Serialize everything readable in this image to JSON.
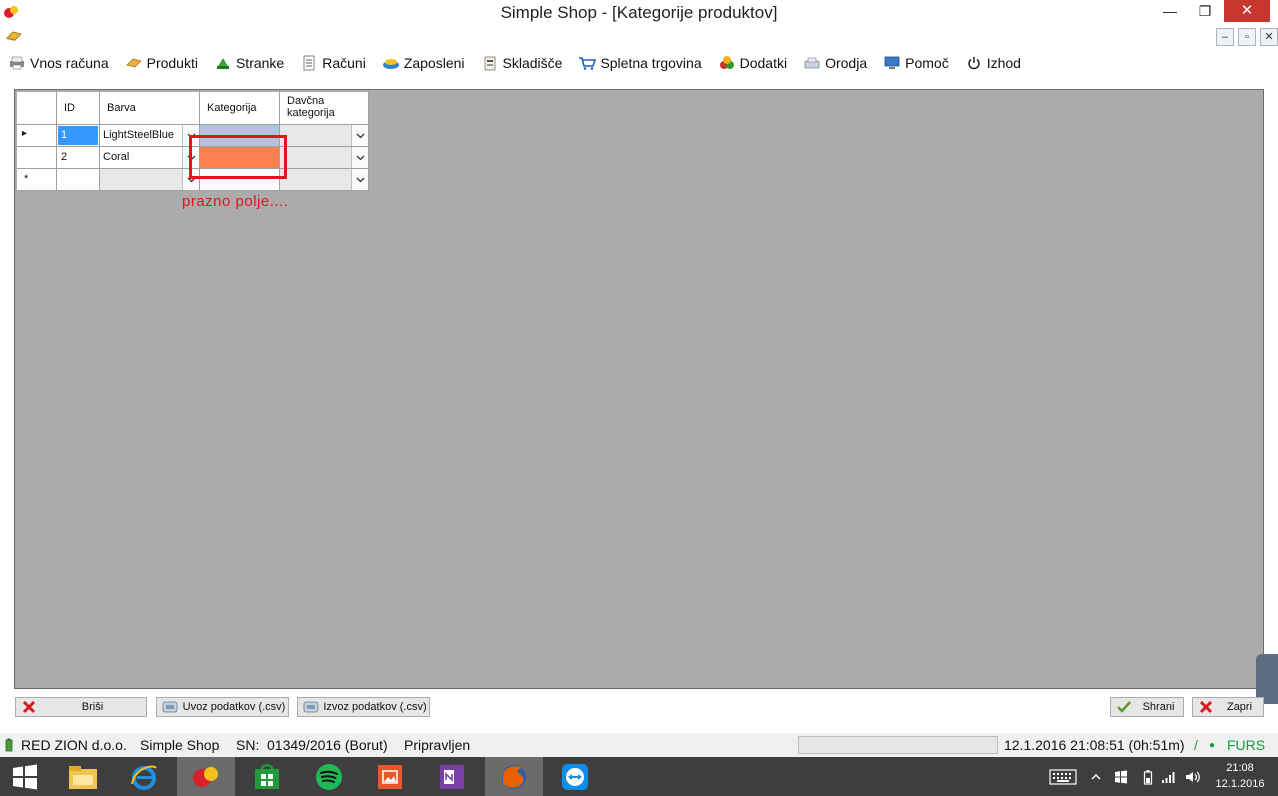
{
  "window": {
    "title": "Simple Shop - [Kategorije produktov]",
    "min_glyph": "—",
    "max_glyph": "❐",
    "close_glyph": "✕"
  },
  "mdi": {
    "min_glyph": "–",
    "restore_glyph": "▫",
    "close_glyph": "✕"
  },
  "menu": [
    {
      "label": "Vnos računa",
      "icon": "printer-icon"
    },
    {
      "label": "Produkti",
      "icon": "products-icon"
    },
    {
      "label": "Stranke",
      "icon": "customers-icon"
    },
    {
      "label": "Računi",
      "icon": "invoices-icon"
    },
    {
      "label": "Zaposleni",
      "icon": "employees-icon"
    },
    {
      "label": "Skladišče",
      "icon": "warehouse-icon"
    },
    {
      "label": "Spletna trgovina",
      "icon": "cart-icon"
    },
    {
      "label": "Dodatki",
      "icon": "addons-icon"
    },
    {
      "label": "Orodja",
      "icon": "tools-icon"
    },
    {
      "label": "Pomoč",
      "icon": "help-icon"
    },
    {
      "label": "Izhod",
      "icon": "power-icon"
    }
  ],
  "grid": {
    "headers": {
      "id": "ID",
      "color": "Barva",
      "category": "Kategorija",
      "tax_line1": "Davčna",
      "tax_line2": "kategorija"
    },
    "rows": [
      {
        "indicator": "▸",
        "id": "1",
        "color": "LightSteelBlue",
        "color_hex": "#b0c4de",
        "category": "",
        "tax": ""
      },
      {
        "indicator": "",
        "id": "2",
        "color": "Coral",
        "color_hex": "#ff7f50",
        "category": "",
        "tax": ""
      }
    ],
    "new_row_indicator": "*"
  },
  "annotation": {
    "text": "prazno polje....",
    "color": "#e3141b"
  },
  "buttons": {
    "delete": "Briši",
    "import": "Uvoz podatkov (.csv)",
    "export": "Izvoz podatkov (.csv)",
    "save": "Shrani",
    "close": "Zapri"
  },
  "status": {
    "company": "RED ZION d.o.o.",
    "app": "Simple Shop",
    "sn_label": "SN:",
    "sn": "01349/2016 (Borut)",
    "state": "Pripravljen",
    "datetime": "12.1.2016 21:08:51 (0h:51m)",
    "sep": "/",
    "furs_dot": "●",
    "furs": "FURS"
  },
  "taskbar": {
    "clock_time": "21:08",
    "clock_date": "12.1.2016"
  },
  "colors": {
    "workspace": "#ababab",
    "accent_red": "#e3141b",
    "selected_cell": "#3399ff",
    "furs_green": "#1a9b3a"
  }
}
